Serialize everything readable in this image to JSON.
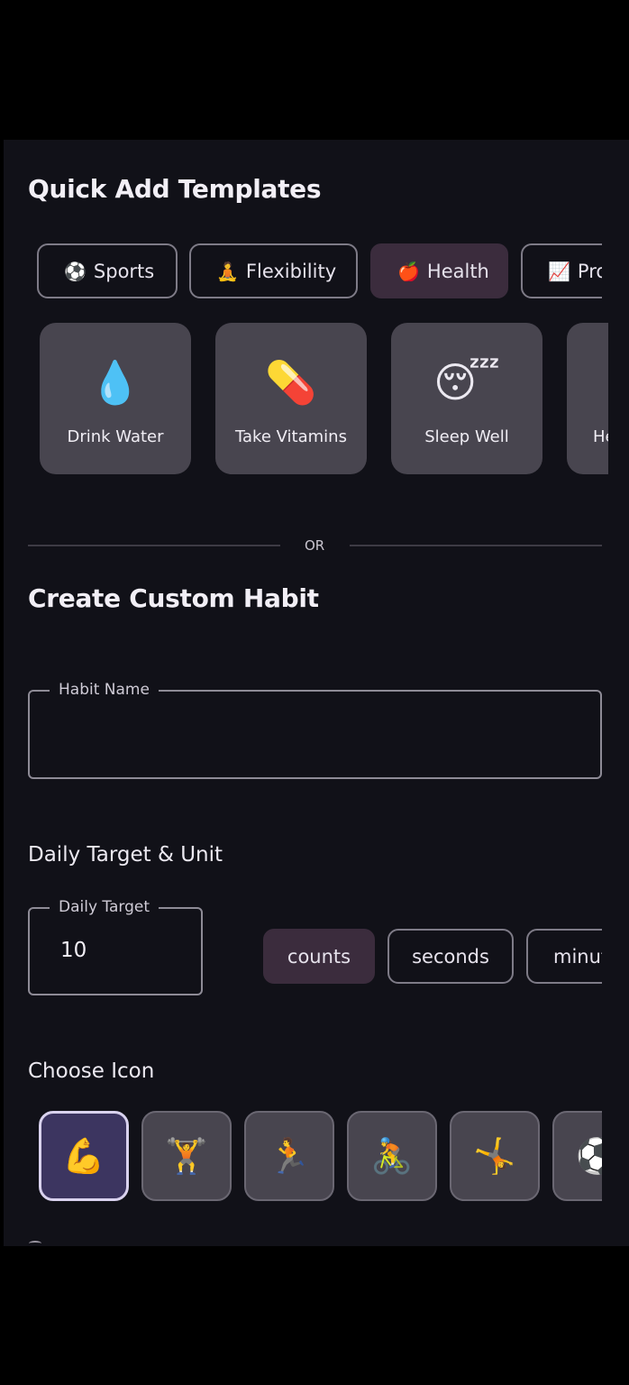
{
  "quick_add": {
    "title": "Quick Add Templates",
    "categories": [
      {
        "icon": "⚽",
        "label": "Sports",
        "selected": false
      },
      {
        "icon": "🧘",
        "label": "Flexibility",
        "selected": false
      },
      {
        "icon": "🍎",
        "label": "Health",
        "selected": true
      },
      {
        "icon": "📈",
        "label": "Productivity",
        "selected": false
      }
    ],
    "templates": [
      {
        "icon": "💧",
        "label": "Drink Water"
      },
      {
        "icon": "💊",
        "label": "Take Vitamins"
      },
      {
        "icon": "😴",
        "label": "Sleep Well"
      },
      {
        "icon": "",
        "label": "He"
      }
    ]
  },
  "divider": {
    "label": "OR"
  },
  "custom": {
    "title": "Create Custom Habit",
    "habit_name": {
      "label": "Habit Name",
      "value": ""
    },
    "daily_target_section": "Daily Target & Unit",
    "daily_target": {
      "label": "Daily Target",
      "value": "10"
    },
    "units": [
      {
        "label": "counts",
        "selected": true
      },
      {
        "label": "seconds",
        "selected": false
      },
      {
        "label": "minutes",
        "selected": false
      }
    ],
    "choose_icon_title": "Choose Icon",
    "icons": [
      {
        "glyph": "💪",
        "name": "flexed-biceps",
        "selected": true
      },
      {
        "glyph": "🏋️",
        "name": "weightlifter",
        "selected": false
      },
      {
        "glyph": "🏃",
        "name": "runner",
        "selected": false
      },
      {
        "glyph": "🚴",
        "name": "cyclist",
        "selected": false
      },
      {
        "glyph": "🤸",
        "name": "cartwheel",
        "selected": false
      },
      {
        "glyph": "⚽",
        "name": "soccer-ball",
        "selected": false
      }
    ]
  },
  "colors": {
    "background": "#111118",
    "card": "#48454F",
    "selected_chip": "#3B2C3D",
    "selected_icon": "#3C3560",
    "outline": "#7E7B87"
  }
}
